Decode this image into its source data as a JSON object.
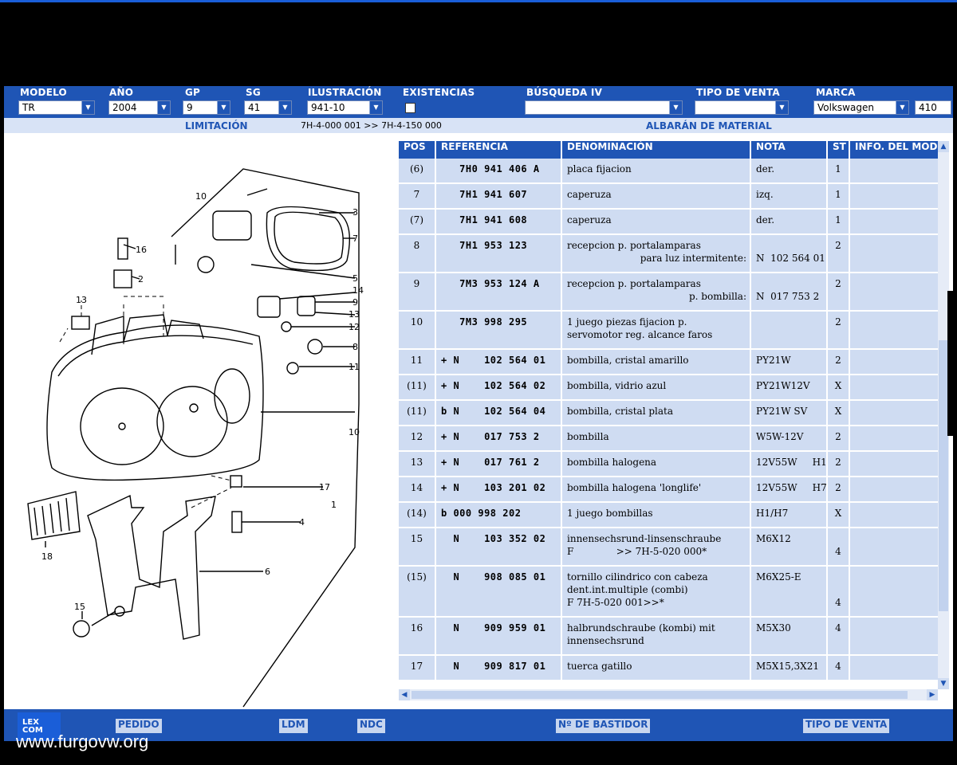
{
  "filters": {
    "modelo": {
      "label": "MODELO",
      "value": "TR"
    },
    "anio": {
      "label": "AÑO",
      "value": "2004"
    },
    "gp": {
      "label": "GP",
      "value": "9"
    },
    "sg": {
      "label": "SG",
      "value": "41"
    },
    "ilustracion": {
      "label": "ILUSTRACIÓN",
      "value": "941-10"
    },
    "existencias": {
      "label": "EXISTENCIAS",
      "checked": false
    },
    "busqueda": {
      "label": "BÚSQUEDA IV",
      "value": ""
    },
    "tipo_venta": {
      "label": "TIPO DE VENTA",
      "value": ""
    },
    "marca": {
      "label": "MARCA",
      "value": "Volkswagen",
      "code": "410"
    }
  },
  "limitacion": {
    "label": "LIMITACIÓN",
    "value": "7H-4-000 001 >> 7H-4-150 000",
    "albaran": "ALBARÁN DE MATERIAL"
  },
  "table": {
    "headers": {
      "pos": "POS",
      "referencia": "REFERENCIA",
      "denominacion": "DENOMINACIÓN",
      "nota": "NOTA",
      "st": "ST",
      "info": "INFO. DEL MODELO"
    },
    "rows": [
      {
        "pos": "(6)",
        "ref": "   7H0 941 406 A",
        "den": [
          "placa fijacion"
        ],
        "nota": [
          "der."
        ],
        "st": "1"
      },
      {
        "pos": "7",
        "ref": "   7H1 941 607",
        "den": [
          "caperuza"
        ],
        "nota": [
          "izq."
        ],
        "st": "1"
      },
      {
        "pos": "(7)",
        "ref": "   7H1 941 608",
        "den": [
          "caperuza"
        ],
        "nota": [
          "der."
        ],
        "st": "1"
      },
      {
        "pos": "8",
        "ref": "   7H1 953 123",
        "den": [
          "recepcion p. portalamparas",
          "para luz intermitente:"
        ],
        "nota": [
          "",
          "N  102 564 01"
        ],
        "st": "2"
      },
      {
        "pos": "9",
        "ref": "   7M3 953 124 A",
        "den": [
          "recepcion p. portalamparas",
          "p. bombilla:"
        ],
        "nota": [
          "",
          "N  017 753 2"
        ],
        "st": "2"
      },
      {
        "pos": "10",
        "ref": "   7M3 998 295",
        "den": [
          "1 juego piezas fijacion p.",
          "servomotor reg. alcance faros"
        ],
        "nota": [
          ""
        ],
        "st": "2"
      },
      {
        "pos": "11",
        "ref": "+ N    102 564 01",
        "den": [
          "bombilla, cristal amarillo"
        ],
        "nota": [
          "PY21W"
        ],
        "st": "2"
      },
      {
        "pos": "(11)",
        "ref": "+ N    102 564 02",
        "den": [
          "bombilla, vidrio azul"
        ],
        "nota": [
          "PY21W12V"
        ],
        "st": "X"
      },
      {
        "pos": "(11)",
        "ref": "b N    102 564 04",
        "den": [
          "bombilla, cristal plata"
        ],
        "nota": [
          "PY21W SV"
        ],
        "st": "X"
      },
      {
        "pos": "12",
        "ref": "+ N    017 753 2",
        "den": [
          "bombilla"
        ],
        "nota": [
          "W5W-12V"
        ],
        "st": "2"
      },
      {
        "pos": "13",
        "ref": "+ N    017 761 2",
        "den": [
          "bombilla halogena"
        ],
        "nota": [
          "12V55W     H1"
        ],
        "st": "2"
      },
      {
        "pos": "14",
        "ref": "+ N    103 201 02",
        "den": [
          "bombilla halogena 'longlife'"
        ],
        "nota": [
          "12V55W     H7"
        ],
        "st": "2"
      },
      {
        "pos": "(14)",
        "ref": "b 000 998 202",
        "den": [
          "1 juego bombillas"
        ],
        "nota": [
          "H1/H7"
        ],
        "st": "X"
      },
      {
        "pos": "15",
        "ref": "  N    103 352 02",
        "den": [
          "innensechsrund-linsenschraube",
          "F              >> 7H-5-020 000*"
        ],
        "nota": [
          "M6X12"
        ],
        "st": "4"
      },
      {
        "pos": "(15)",
        "ref": "  N    908 085 01",
        "den": [
          "tornillo cilindrico con cabeza",
          "dent.int.multiple (combi)",
          "F 7H-5-020 001>>*"
        ],
        "nota": [
          "M6X25-E"
        ],
        "st": "4"
      },
      {
        "pos": "16",
        "ref": "  N    909 959 01",
        "den": [
          "halbrundschraube (kombi) mit",
          "innensechsrund"
        ],
        "nota": [
          "M5X30"
        ],
        "st": "4"
      },
      {
        "pos": "17",
        "ref": "  N    909 817 01",
        "den": [
          "tuerca gatillo"
        ],
        "nota": [
          "M5X15,3X21"
        ],
        "st": "4"
      }
    ]
  },
  "diagram": {
    "callouts": [
      "10",
      "3",
      "7",
      "16",
      "2",
      "5",
      "14",
      "9",
      "13",
      "13",
      "12",
      "8",
      "11",
      "10",
      "17",
      "1",
      "4",
      "18",
      "6",
      "15"
    ]
  },
  "bottom": {
    "pedido": "PEDIDO",
    "ldm": "LDM",
    "ndc": "NDC",
    "bastidor": "Nº DE BASTIDOR",
    "tipo_venta": "TIPO DE VENTA"
  },
  "logo": {
    "line1": "LEX",
    "line2": "COM"
  },
  "watermark": "www.furgovw.org"
}
